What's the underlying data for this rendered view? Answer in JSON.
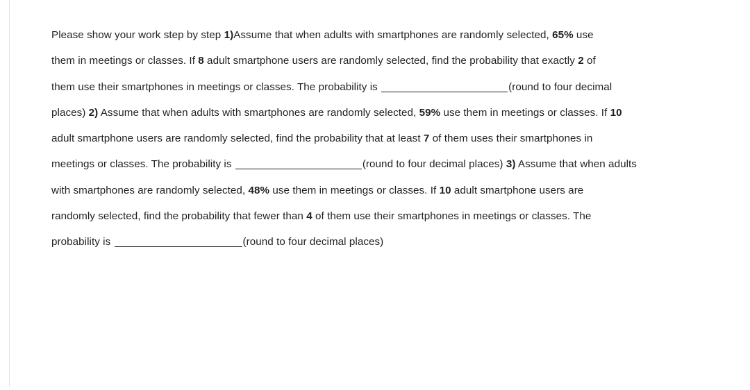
{
  "document": {
    "type": "homework-question-text",
    "instruction": "Please show your work step by step",
    "text_color": "#231f20",
    "rule_color": "#e3e3e3",
    "full_text": "Please show your work step by step 1)Assume that when adults with smartphones are randomly selected, 65% use them in meetings or classes. If 8 adult smartphone users are randomly selected, find the probability that exactly 2 of them use their smartphones in meetings or classes. The probability is ____________________(round to four decimal places) 2) Assume that when adults with smartphones are randomly selected, 59% use them in meetings or classes. If 10 adult smartphone users are randomly selected, find the probability that at least 7 of them uses their smartphones in meetings or classes. The probability is ____________________(round to four decimal places) 3) Assume that when adults with smartphones are randomly selected, 48% use them in meetings or classes. If 10 adult smartphone users are randomly selected, find the probability that fewer than 4 of them use their smartphones in meetings or classes. The probability is ____________________(round to four decimal places)",
    "lines": [
      {
        "id": "line-1",
        "parts": [
          {
            "text": "Please show your work step by step ",
            "bold": false
          },
          {
            "text": "1)",
            "bold": true
          },
          {
            "text": "Assume that when adults with smartphones are randomly selected, ",
            "bold": false
          },
          {
            "text": "65%",
            "bold": true
          },
          {
            "text": " use",
            "bold": false
          }
        ]
      },
      {
        "id": "line-2",
        "parts": [
          {
            "text": "them in meetings or classes. If ",
            "bold": false
          },
          {
            "text": "8",
            "bold": true
          },
          {
            "text": " adult smartphone users are randomly selected, find the probability that exactly ",
            "bold": false
          },
          {
            "text": "2",
            "bold": true
          },
          {
            "text": " of",
            "bold": false
          }
        ]
      },
      {
        "id": "line-3",
        "parts": [
          {
            "text": "them use their smartphones in meetings or classes. The probability is ",
            "bold": false
          },
          {
            "blank": "w1"
          },
          {
            "text": "(round to four decimal",
            "bold": false
          }
        ]
      },
      {
        "id": "line-4",
        "parts": [
          {
            "text": "places) ",
            "bold": false
          },
          {
            "text": "2)",
            "bold": true
          },
          {
            "text": " Assume that when adults with smartphones are randomly selected, ",
            "bold": false
          },
          {
            "text": "59%",
            "bold": true
          },
          {
            "text": " use them in meetings or classes. If ",
            "bold": false
          },
          {
            "text": "10",
            "bold": true
          }
        ]
      },
      {
        "id": "line-5",
        "parts": [
          {
            "text": "adult smartphone users are randomly selected, find the probability that at least ",
            "bold": false
          },
          {
            "text": "7",
            "bold": true
          },
          {
            "text": " of them uses their smartphones in",
            "bold": false
          }
        ]
      },
      {
        "id": "line-6",
        "parts": [
          {
            "text": "meetings or classes. The probability is ",
            "bold": false
          },
          {
            "blank": "w2"
          },
          {
            "text": "(round to four decimal places) ",
            "bold": false
          },
          {
            "text": "3)",
            "bold": true
          },
          {
            "text": " Assume that when adults",
            "bold": false
          }
        ]
      },
      {
        "id": "line-7",
        "parts": [
          {
            "text": "with smartphones are randomly selected, ",
            "bold": false
          },
          {
            "text": "48%",
            "bold": true
          },
          {
            "text": " use them in meetings or classes. If ",
            "bold": false
          },
          {
            "text": "10",
            "bold": true
          },
          {
            "text": " adult smartphone users are",
            "bold": false
          }
        ]
      },
      {
        "id": "line-8",
        "parts": [
          {
            "text": "randomly selected, find the probability that fewer than ",
            "bold": false
          },
          {
            "text": "4",
            "bold": true
          },
          {
            "text": " of them use their smartphones in meetings or classes. The",
            "bold": false
          }
        ]
      },
      {
        "id": "line-9",
        "parts": [
          {
            "text": "probability is ",
            "bold": false
          },
          {
            "blank": "w3"
          },
          {
            "text": "(round to four decimal places)",
            "bold": false
          }
        ]
      }
    ],
    "questions": [
      {
        "number": "1)",
        "percent": "65%",
        "sample_size": "8",
        "condition": "exactly 2",
        "answer_value": "",
        "rounding_note": "(round to four decimal places)"
      },
      {
        "number": "2)",
        "percent": "59%",
        "sample_size": "10",
        "condition": "at least 7",
        "answer_value": "",
        "rounding_note": "(round to four decimal places)"
      },
      {
        "number": "3)",
        "percent": "48%",
        "sample_size": "10",
        "condition": "fewer than 4",
        "answer_value": "",
        "rounding_note": "(round to four decimal places)"
      }
    ]
  }
}
